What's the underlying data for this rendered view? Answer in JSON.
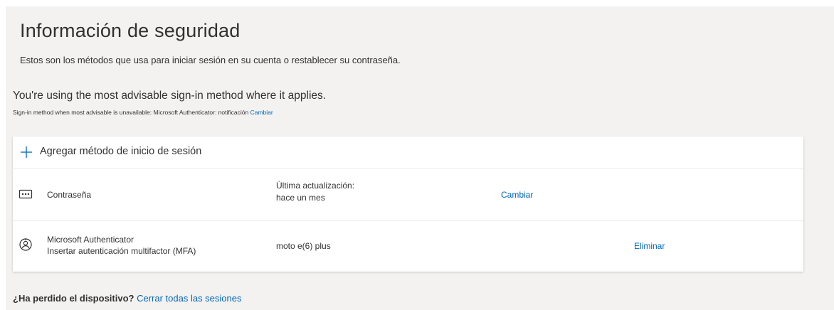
{
  "header": {
    "title": "Información de seguridad",
    "subtitle": "Estos son los métodos que usa para iniciar sesión en su cuenta o restablecer su contraseña."
  },
  "advice": {
    "main": "You're using the most advisable sign-in method where it applies.",
    "sub_text": "Sign-in method when most advisable is unavailable: Microsoft Authenticator: notificación",
    "sub_link": "Cambiar"
  },
  "methods": {
    "add_label": "Agregar método de inicio de sesión",
    "password": {
      "name": "Contraseña",
      "updated_label": "Última actualización:",
      "updated_value": "hace un mes",
      "action": "Cambiar"
    },
    "authenticator": {
      "name": "Microsoft Authenticator",
      "description": "Insertar autenticación multifactor (MFA)",
      "device": "moto e(6) plus",
      "action": "Eliminar"
    }
  },
  "lost_device": {
    "question": "¿Ha perdido el dispositivo?",
    "link": "Cerrar todas las sesiones"
  },
  "colors": {
    "background": "#f3f2f1",
    "card": "#ffffff",
    "link": "#0067b8",
    "text": "#323130"
  }
}
